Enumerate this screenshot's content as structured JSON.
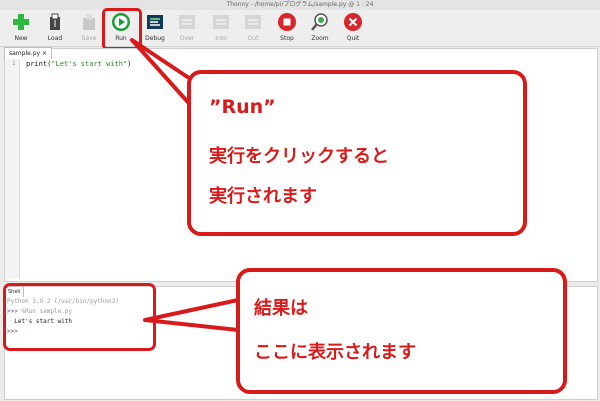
{
  "window_title": "Thonny - /home/pi/プログラム/sample.py @ 1 : 24",
  "toolbar": [
    {
      "label": "New",
      "icon": "new-file-icon",
      "enabled": true
    },
    {
      "label": "Load",
      "icon": "load-icon",
      "enabled": true
    },
    {
      "label": "Save",
      "icon": "save-icon",
      "enabled": false
    },
    {
      "label": "Run",
      "icon": "run-icon",
      "enabled": true
    },
    {
      "label": "Debug",
      "icon": "debug-icon",
      "enabled": true
    },
    {
      "label": "Over",
      "icon": "step-over-icon",
      "enabled": false
    },
    {
      "label": "Into",
      "icon": "step-into-icon",
      "enabled": false
    },
    {
      "label": "Out",
      "icon": "step-out-icon",
      "enabled": false
    },
    {
      "label": "Stop",
      "icon": "stop-icon",
      "enabled": true
    },
    {
      "label": "Zoom",
      "icon": "zoom-icon",
      "enabled": true
    },
    {
      "label": "Quit",
      "icon": "quit-icon",
      "enabled": true
    }
  ],
  "editor": {
    "tab_label": "sample.py ×",
    "line_number": "1",
    "code_fn": "print(",
    "code_str": "\"Let's start with\"",
    "code_end": ")"
  },
  "shell": {
    "tab_label": "Shell",
    "version_line": "Python 3.9.2 (/usr/bin/python3)",
    "prompt1": ">>> ",
    "run_cmd": "%Run sample.py",
    "output": "  Let's start with",
    "prompt2": ">>>"
  },
  "callouts": {
    "run": {
      "line1": "”Run”",
      "line2": "実行をクリックすると",
      "line3": "実行されます"
    },
    "result": {
      "line1": "結果は",
      "line2": "ここに表示されます"
    }
  },
  "colors": {
    "annotation_red": "#d91a1a",
    "run_green": "#1e9c3a",
    "stop_red": "#d9262c"
  }
}
